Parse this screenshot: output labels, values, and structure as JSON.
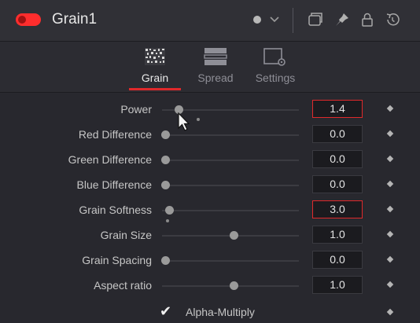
{
  "header": {
    "title": "Grain1",
    "enabled": true
  },
  "tabs": [
    {
      "label": "Grain",
      "active": true
    },
    {
      "label": "Spread",
      "active": false
    },
    {
      "label": "Settings",
      "active": false
    }
  ],
  "params": [
    {
      "label": "Power",
      "value": "1.4",
      "slider_fraction": 0.1,
      "active": true
    },
    {
      "label": "Red Difference",
      "value": "0.0",
      "slider_fraction": 0.0,
      "active": false
    },
    {
      "label": "Green Difference",
      "value": "0.0",
      "slider_fraction": 0.0,
      "active": false
    },
    {
      "label": "Blue Difference",
      "value": "0.0",
      "slider_fraction": 0.0,
      "active": false
    },
    {
      "label": "Grain Softness",
      "value": "3.0",
      "slider_fraction": 0.03,
      "active": true
    },
    {
      "label": "Grain Size",
      "value": "1.0",
      "slider_fraction": 0.5,
      "active": false
    },
    {
      "label": "Grain Spacing",
      "value": "0.0",
      "slider_fraction": 0.0,
      "active": false
    },
    {
      "label": "Aspect ratio",
      "value": "1.0",
      "slider_fraction": 0.5,
      "active": false
    }
  ],
  "alpha_multiply": {
    "label": "Alpha-Multiply",
    "checked": true
  },
  "colors": {
    "accent": "#e0292b",
    "background": "#28282e"
  }
}
